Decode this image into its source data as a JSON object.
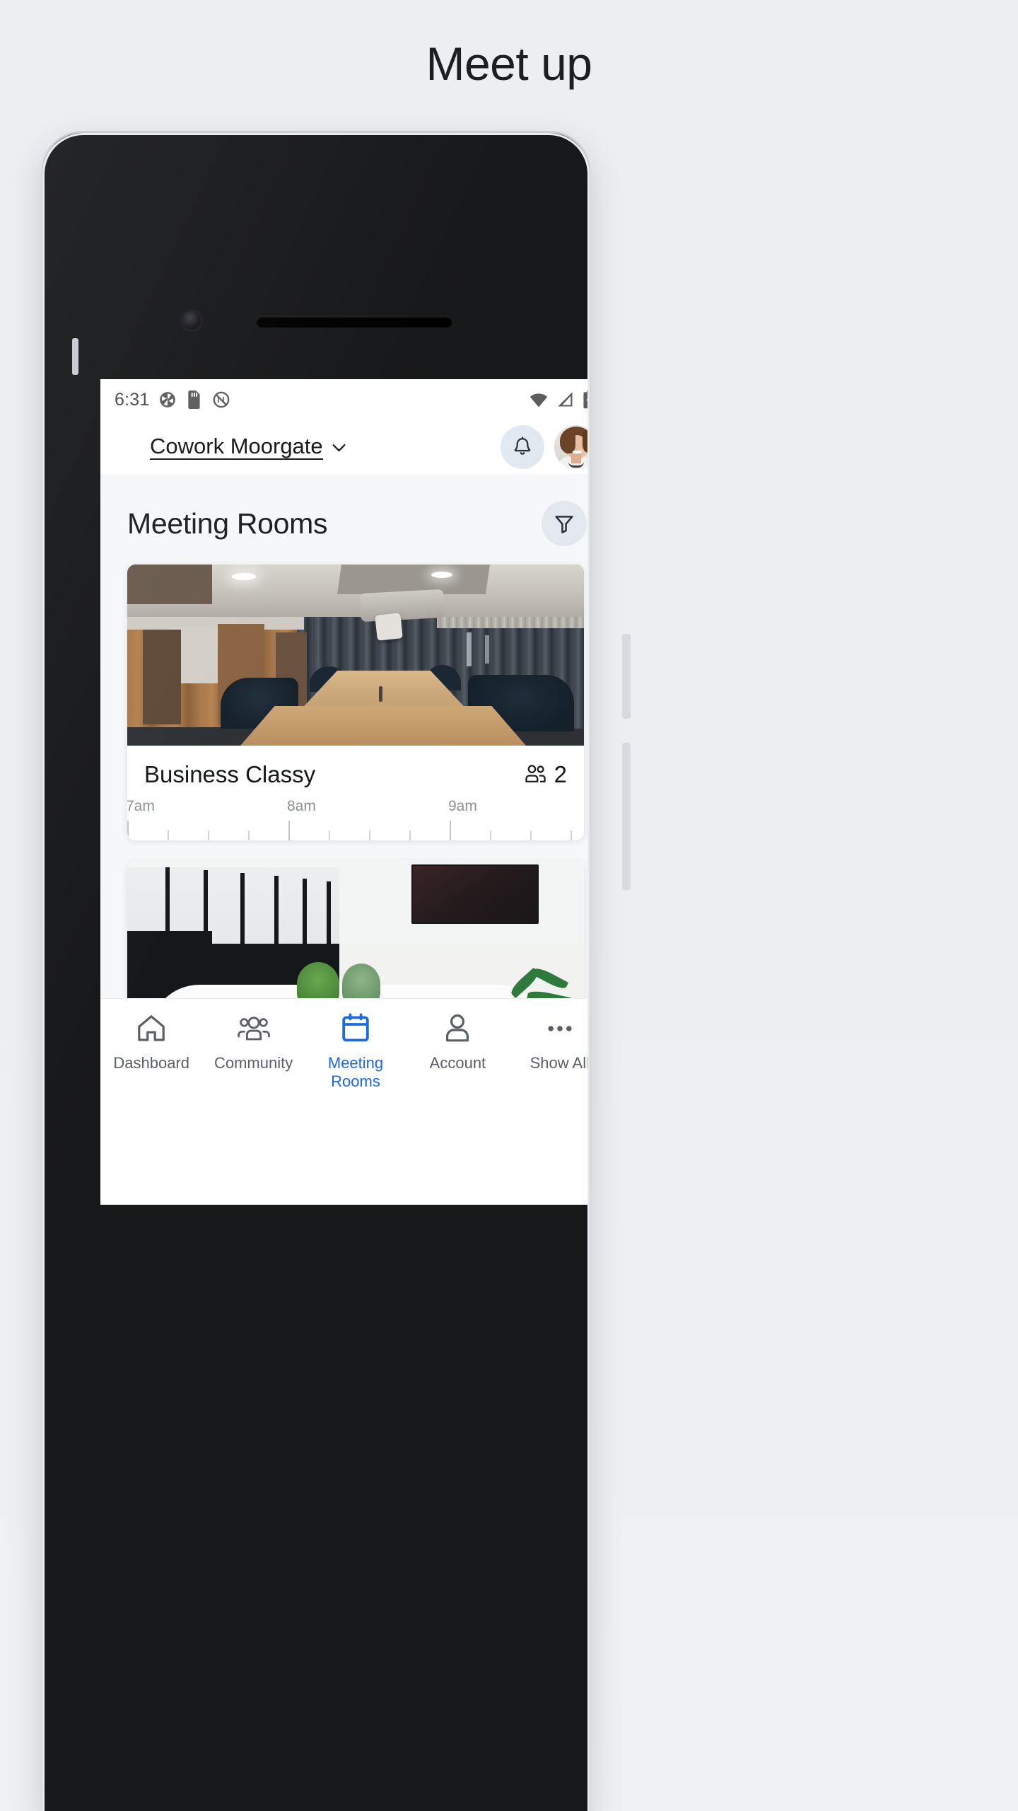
{
  "hero": {
    "title": "Meet up"
  },
  "status_bar": {
    "time": "6:31",
    "left_icons": [
      "camera-aperture-icon",
      "sd-card-icon",
      "do-not-disturb-icon"
    ],
    "right_icons": [
      "wifi-icon",
      "cellular-signal-icon",
      "battery-charging-icon"
    ]
  },
  "app_bar": {
    "venue_name": "Cowork Moorgate",
    "venue_chevron": "chevron-down-icon",
    "notifications_icon": "bell-icon",
    "avatar": "user-avatar"
  },
  "page": {
    "title": "Meeting Rooms",
    "filter_icon": "filter-funnel-icon"
  },
  "rooms": [
    {
      "name": "Business Classy",
      "capacity": "2",
      "capacity_icon": "people-icon",
      "image": "conference-room-wood-table",
      "timeline": {
        "labels": [
          "7am",
          "8am",
          "9am"
        ],
        "hours": 3,
        "minor_ticks_per_hour": 4
      }
    },
    {
      "name": "",
      "capacity": "",
      "capacity_icon": "people-icon",
      "image": "white-meeting-room-plants",
      "timeline": {
        "labels": [],
        "hours": 0,
        "minor_ticks_per_hour": 4
      }
    }
  ],
  "bottom_nav": {
    "active_color": "#1a6ae8",
    "inactive_color": "#5a5f66",
    "items": [
      {
        "label": "Dashboard",
        "icon": "home-icon",
        "active": false
      },
      {
        "label": "Community",
        "icon": "people-icon",
        "active": false
      },
      {
        "label": "Meeting\nRooms",
        "icon": "calendar-icon",
        "active": true
      },
      {
        "label": "Account",
        "icon": "person-icon",
        "active": false
      },
      {
        "label": "Show All",
        "icon": "ellipsis-icon",
        "active": false
      }
    ]
  },
  "colors": {
    "canvas": "#eceff2",
    "screen_bg": "#f5f7f9",
    "card_bg": "#ffffff",
    "accent_blue": "#1a6ae8",
    "icon_circle": "#e2e8f0",
    "text_primary": "#15181b",
    "text_muted": "#8b9097"
  }
}
